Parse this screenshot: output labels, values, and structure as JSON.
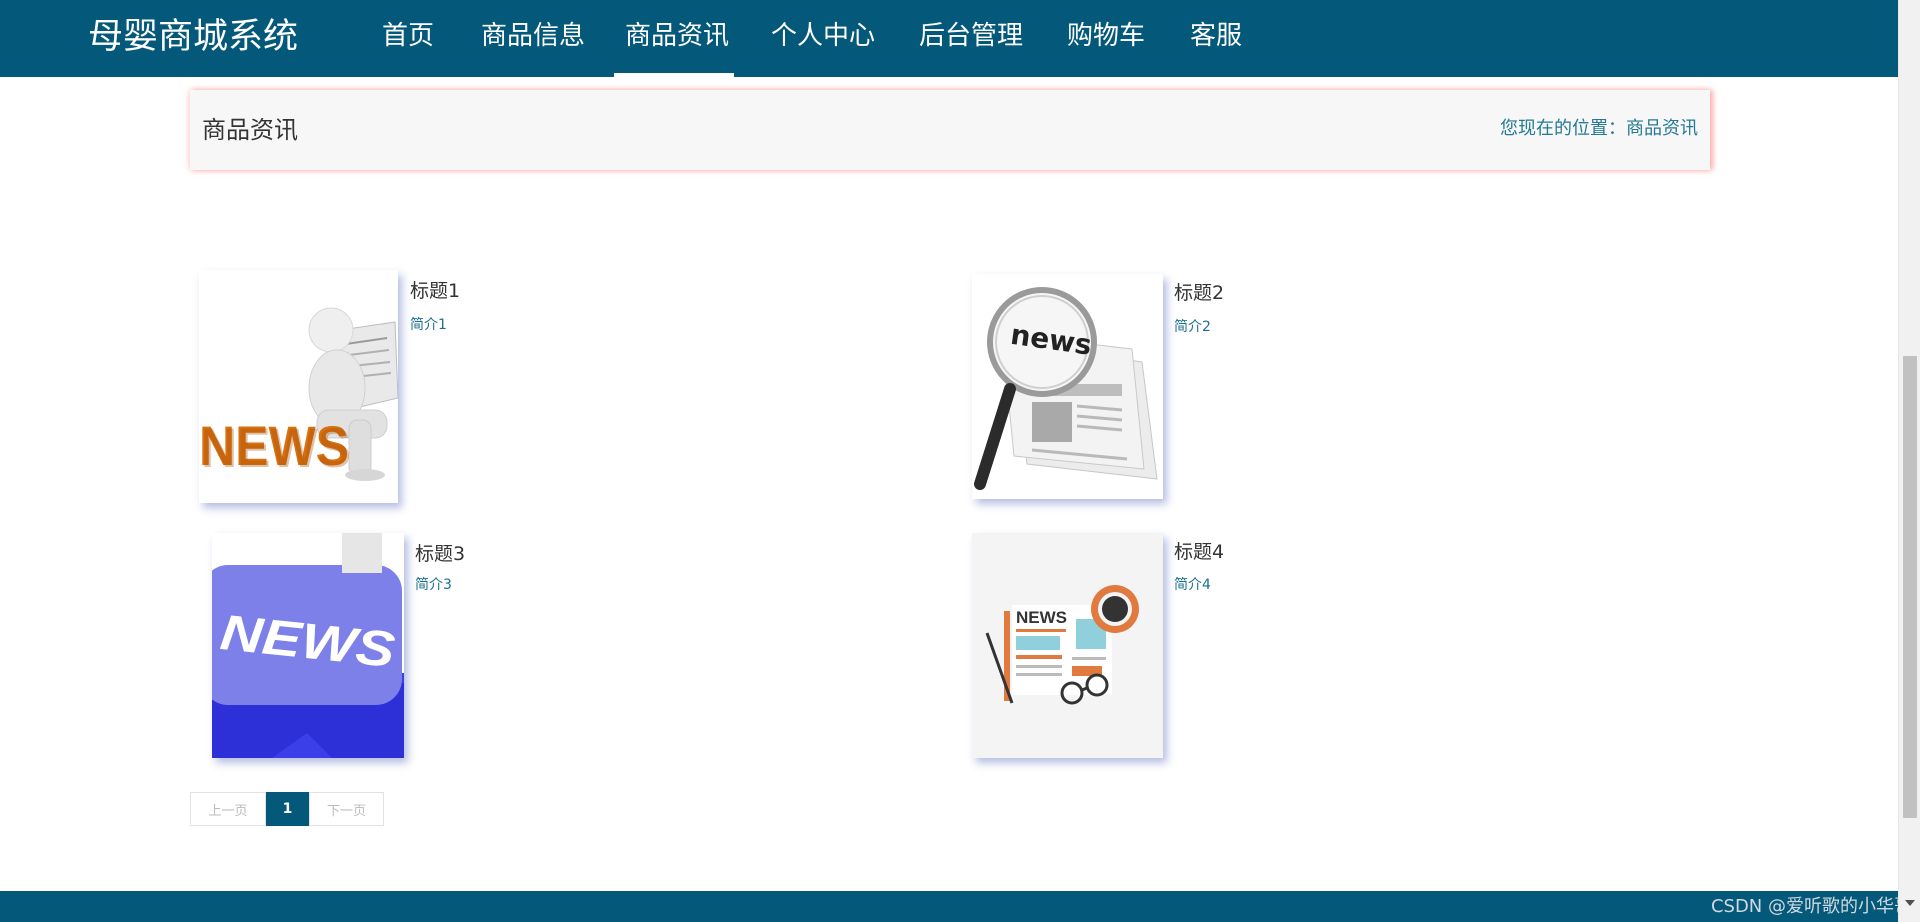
{
  "header": {
    "brand": "母婴商城系统",
    "nav": [
      "首页",
      "商品信息",
      "商品资讯",
      "个人中心",
      "后台管理",
      "购物车",
      "客服"
    ],
    "active_nav": "商品资讯"
  },
  "section": {
    "title": "商品资讯",
    "breadcrumb_prefix": "您现在的位置：",
    "breadcrumb_current": "商品资讯"
  },
  "news": [
    {
      "title": "标题1",
      "desc": "简介1",
      "image": "news-3d-figure-reading"
    },
    {
      "title": "标题2",
      "desc": "简介2",
      "image": "news-magnifier-newspaper"
    },
    {
      "title": "标题3",
      "desc": "简介3",
      "image": "news-keyboard-key"
    },
    {
      "title": "标题4",
      "desc": "简介4",
      "image": "news-flat-newspaper-coffee"
    }
  ],
  "pagination": {
    "prev": "上一页",
    "current": "1",
    "next": "下一页"
  },
  "watermark": "CSDN @爱听歌的小华哥",
  "colors": {
    "primary": "#04587a",
    "link": "#1d6f8e",
    "active_underline": "#ffffff"
  }
}
